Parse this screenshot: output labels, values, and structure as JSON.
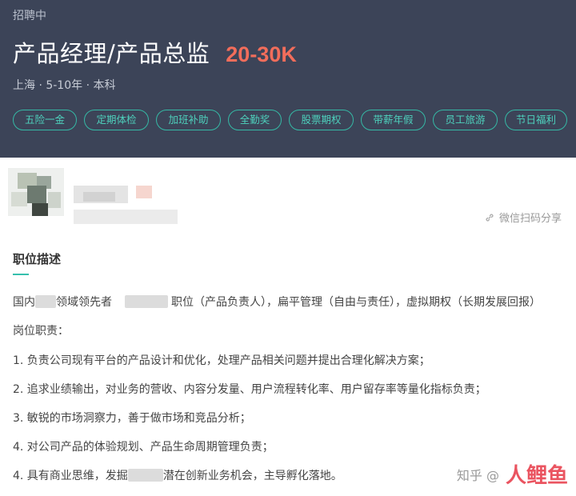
{
  "header": {
    "status": "招聘中",
    "title": "产品经理/产品总监",
    "salary": "20-30K",
    "meta": "上海 · 5-10年 · 本科",
    "tags": [
      "五险一金",
      "定期体检",
      "加班补助",
      "全勤奖",
      "股票期权",
      "带薪年假",
      "员工旅游",
      "节日福利"
    ]
  },
  "share": {
    "label": "微信扫码分享",
    "icon": "link-icon"
  },
  "description": {
    "title": "职位描述",
    "line1_a": "国内",
    "line1_b": "领域领先者",
    "line1_c": "职位（产品负责人），扁平管理（自由与责任），虚拟期权（长期发展回报）",
    "duties_title": "岗位职责：",
    "duty1": "1. 负责公司现有平台的产品设计和优化，处理产品相关问题并提出合理化解决方案；",
    "duty2": "2. 追求业绩输出，对业务的营收、内容分发量、用户流程转化率、用户留存率等量化指标负责；",
    "duty3": "3. 敏锐的市场洞察力，善于做市场和竞品分析；",
    "duty4": "4. 对公司产品的体验规划、产品生命周期管理负责；",
    "duty5_a": "4. 具有商业思维，发掘",
    "duty5_b": "潜在创新业务机会，主导孵化落地。"
  },
  "watermark": {
    "text": "知乎 @",
    "logo": "人鲤鱼"
  },
  "colors": {
    "header_bg": "#3c4458",
    "accent": "#35b8a5",
    "salary": "#f26d5b"
  }
}
